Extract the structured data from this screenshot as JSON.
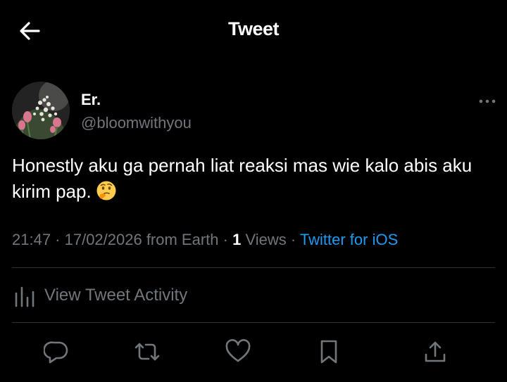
{
  "header": {
    "title": "Tweet",
    "back_icon": "arrow-left-icon"
  },
  "author": {
    "display_name": "Er.",
    "handle": "@bloomwithyou",
    "avatar": "avatar-flowers"
  },
  "tweet": {
    "text": "Honestly aku ga pernah liat reaksi mas wie kalo abis aku kirim pap.",
    "emoji": "thinking-face-emoji"
  },
  "meta": {
    "time_date": "21:47 · 17/02/2026 from Earth",
    "sep1": " · ",
    "views_count": "1",
    "views_label": " Views",
    "sep2": " · ",
    "source": "Twitter for iOS"
  },
  "activity": {
    "label": "View Tweet Activity"
  },
  "actions": [
    "reply-icon",
    "retweet-icon",
    "like-icon",
    "bookmark-icon",
    "share-icon"
  ],
  "colors": {
    "background": "#000000",
    "text": "#ffffff",
    "secondary": "#71767b",
    "link": "#1d9bf0",
    "divider": "#2f3336"
  }
}
